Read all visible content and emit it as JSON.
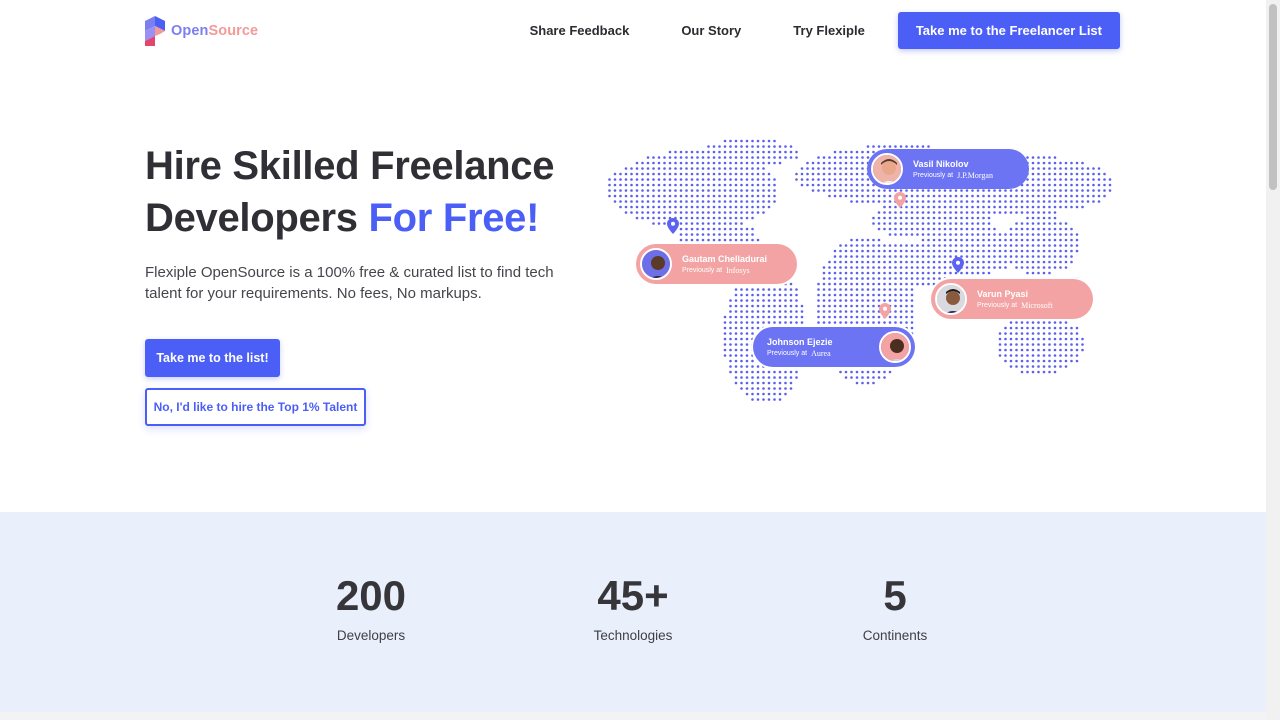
{
  "brand": {
    "name_part1": "Open",
    "name_part2": "Source",
    "logo_colors": [
      "#7b7ff0",
      "#4b5ff7",
      "#f39a98"
    ]
  },
  "nav": {
    "links": [
      "Share Feedback",
      "Our Story",
      "Try Flexiple"
    ],
    "cta": "Take me to the Freelancer List"
  },
  "hero": {
    "title_line1": "Hire Skilled Freelance",
    "title_line2_plain": "Developers ",
    "title_line2_accent": "For Free!",
    "subtitle": "Flexiple OpenSource is a 100% free & curated list to find tech talent for your requirements. No fees, No markups.",
    "primary_button": "Take me to the list!",
    "secondary_button": "No, I'd like to hire the Top 1% Talent"
  },
  "map": {
    "profiles": [
      {
        "name": "Vasil Nikolov",
        "previously": "Previously at",
        "company": "J.P.Morgan"
      },
      {
        "name": "Gautam Chelladurai",
        "previously": "Previously at",
        "company": "Infosys"
      },
      {
        "name": "Varun Pyasi",
        "previously": "Previously at",
        "company": "Microsoft"
      },
      {
        "name": "Johnson Ejezie",
        "previously": "Previously at",
        "company": "Aurea"
      }
    ]
  },
  "stats": [
    {
      "value": "200",
      "label": "Developers"
    },
    {
      "value": "45+",
      "label": "Technologies"
    },
    {
      "value": "5",
      "label": "Continents"
    }
  ],
  "colors": {
    "accent": "#4b5ff7",
    "pink": "#f3a3a3",
    "stats_bg": "#e9effb",
    "dots": "#5b5ff0"
  }
}
